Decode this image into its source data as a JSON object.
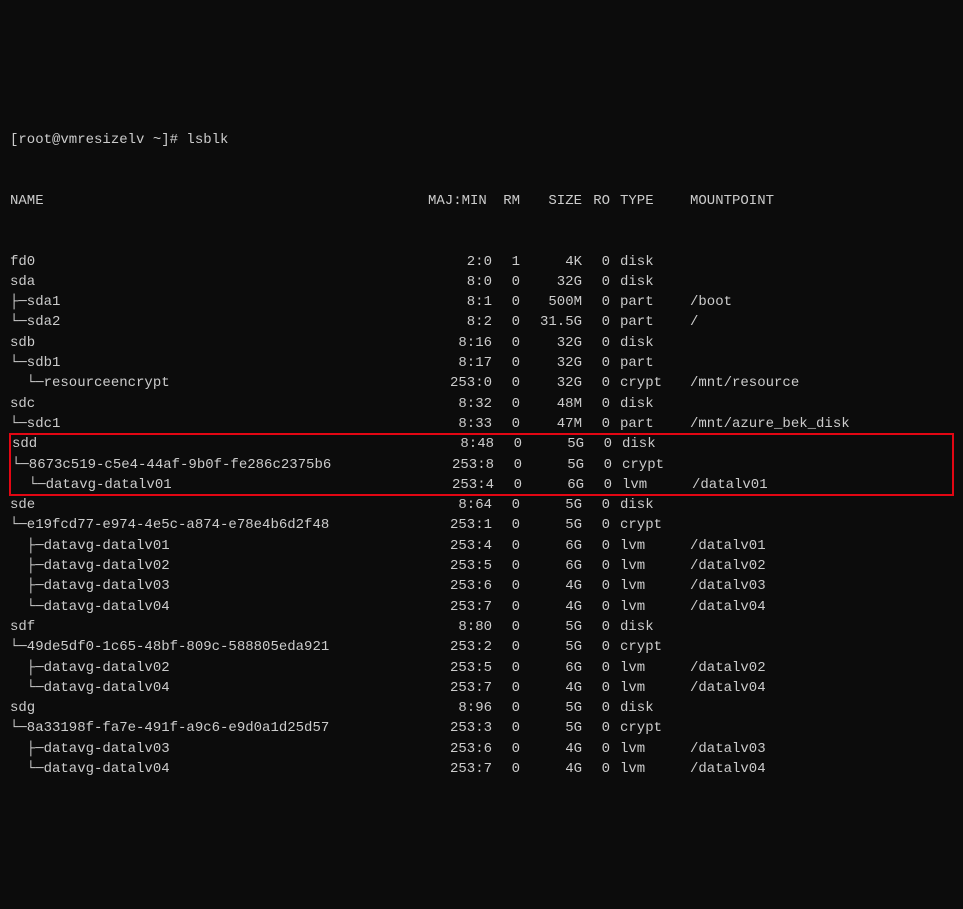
{
  "prompt": "[root@vmresizelv ~]# lsblk",
  "hdr": {
    "name": "NAME",
    "mm": "MAJ:MIN",
    "rm": "RM",
    "sz": "SIZE",
    "ro": "RO",
    "ty": "TYPE",
    "mp": "MOUNTPOINT"
  },
  "rows": [
    {
      "name": "fd0",
      "mm": "2:0",
      "rm": "1",
      "sz": "4K",
      "ro": "0",
      "ty": "disk",
      "mp": ""
    },
    {
      "name": "sda",
      "mm": "8:0",
      "rm": "0",
      "sz": "32G",
      "ro": "0",
      "ty": "disk",
      "mp": ""
    },
    {
      "name": "├─sda1",
      "mm": "8:1",
      "rm": "0",
      "sz": "500M",
      "ro": "0",
      "ty": "part",
      "mp": "/boot"
    },
    {
      "name": "└─sda2",
      "mm": "8:2",
      "rm": "0",
      "sz": "31.5G",
      "ro": "0",
      "ty": "part",
      "mp": "/"
    },
    {
      "name": "sdb",
      "mm": "8:16",
      "rm": "0",
      "sz": "32G",
      "ro": "0",
      "ty": "disk",
      "mp": ""
    },
    {
      "name": "└─sdb1",
      "mm": "8:17",
      "rm": "0",
      "sz": "32G",
      "ro": "0",
      "ty": "part",
      "mp": ""
    },
    {
      "name": "  └─resourceencrypt",
      "mm": "253:0",
      "rm": "0",
      "sz": "32G",
      "ro": "0",
      "ty": "crypt",
      "mp": "/mnt/resource"
    },
    {
      "name": "sdc",
      "mm": "8:32",
      "rm": "0",
      "sz": "48M",
      "ro": "0",
      "ty": "disk",
      "mp": ""
    },
    {
      "name": "└─sdc1",
      "mm": "8:33",
      "rm": "0",
      "sz": "47M",
      "ro": "0",
      "ty": "part",
      "mp": "/mnt/azure_bek_disk"
    },
    {
      "name": "sdd",
      "mm": "8:48",
      "rm": "0",
      "sz": "5G",
      "ro": "0",
      "ty": "disk",
      "mp": "",
      "hl": true
    },
    {
      "name": "└─8673c519-c5e4-44af-9b0f-fe286c2375b6",
      "mm": "253:8",
      "rm": "0",
      "sz": "5G",
      "ro": "0",
      "ty": "crypt",
      "mp": "",
      "hl": true
    },
    {
      "name": "  └─datavg-datalv01",
      "mm": "253:4",
      "rm": "0",
      "sz": "6G",
      "ro": "0",
      "ty": "lvm",
      "mp": "/datalv01",
      "hl": true
    },
    {
      "name": "sde",
      "mm": "8:64",
      "rm": "0",
      "sz": "5G",
      "ro": "0",
      "ty": "disk",
      "mp": ""
    },
    {
      "name": "└─e19fcd77-e974-4e5c-a874-e78e4b6d2f48",
      "mm": "253:1",
      "rm": "0",
      "sz": "5G",
      "ro": "0",
      "ty": "crypt",
      "mp": ""
    },
    {
      "name": "  ├─datavg-datalv01",
      "mm": "253:4",
      "rm": "0",
      "sz": "6G",
      "ro": "0",
      "ty": "lvm",
      "mp": "/datalv01"
    },
    {
      "name": "  ├─datavg-datalv02",
      "mm": "253:5",
      "rm": "0",
      "sz": "6G",
      "ro": "0",
      "ty": "lvm",
      "mp": "/datalv02"
    },
    {
      "name": "  ├─datavg-datalv03",
      "mm": "253:6",
      "rm": "0",
      "sz": "4G",
      "ro": "0",
      "ty": "lvm",
      "mp": "/datalv03"
    },
    {
      "name": "  └─datavg-datalv04",
      "mm": "253:7",
      "rm": "0",
      "sz": "4G",
      "ro": "0",
      "ty": "lvm",
      "mp": "/datalv04"
    },
    {
      "name": "sdf",
      "mm": "8:80",
      "rm": "0",
      "sz": "5G",
      "ro": "0",
      "ty": "disk",
      "mp": ""
    },
    {
      "name": "└─49de5df0-1c65-48bf-809c-588805eda921",
      "mm": "253:2",
      "rm": "0",
      "sz": "5G",
      "ro": "0",
      "ty": "crypt",
      "mp": ""
    },
    {
      "name": "  ├─datavg-datalv02",
      "mm": "253:5",
      "rm": "0",
      "sz": "6G",
      "ro": "0",
      "ty": "lvm",
      "mp": "/datalv02"
    },
    {
      "name": "  └─datavg-datalv04",
      "mm": "253:7",
      "rm": "0",
      "sz": "4G",
      "ro": "0",
      "ty": "lvm",
      "mp": "/datalv04"
    },
    {
      "name": "sdg",
      "mm": "8:96",
      "rm": "0",
      "sz": "5G",
      "ro": "0",
      "ty": "disk",
      "mp": ""
    },
    {
      "name": "└─8a33198f-fa7e-491f-a9c6-e9d0a1d25d57",
      "mm": "253:3",
      "rm": "0",
      "sz": "5G",
      "ro": "0",
      "ty": "crypt",
      "mp": ""
    },
    {
      "name": "  ├─datavg-datalv03",
      "mm": "253:6",
      "rm": "0",
      "sz": "4G",
      "ro": "0",
      "ty": "lvm",
      "mp": "/datalv03"
    },
    {
      "name": "  └─datavg-datalv04",
      "mm": "253:7",
      "rm": "0",
      "sz": "4G",
      "ro": "0",
      "ty": "lvm",
      "mp": "/datalv04"
    }
  ]
}
